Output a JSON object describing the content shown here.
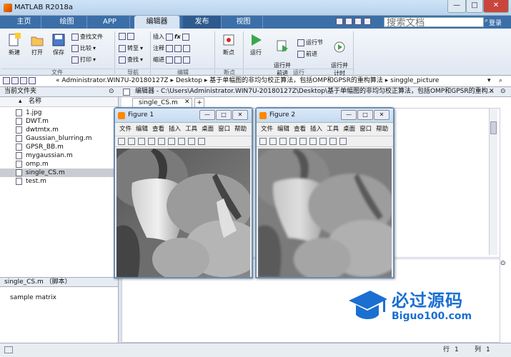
{
  "window": {
    "title": "MATLAB R2018a",
    "min": "—",
    "max": "□",
    "close": "✕"
  },
  "tabs": [
    "主页",
    "绘图",
    "APP",
    "编辑器",
    "发布",
    "视图"
  ],
  "search": {
    "placeholder": "搜索文档",
    "login": "登录"
  },
  "ribbon": {
    "file": {
      "new": "新建",
      "open": "打开",
      "save": "保存",
      "find": "查找文件",
      "compare": "比较",
      "print": "打印",
      "group": "文件"
    },
    "nav": {
      "goto": "转至",
      "find": "查找",
      "group": "导航"
    },
    "edit": {
      "insert": "插入",
      "comment": "注释",
      "indent": "缩进",
      "group": "编辑"
    },
    "breakpoints": {
      "label": "断点",
      "group": "断点"
    },
    "run": {
      "run": "运行",
      "run_advance": "运行并\n前进",
      "run_section": "运行节",
      "advance": "前进",
      "run_time": "运行并\n计时",
      "group": "运行"
    }
  },
  "address": {
    "path": [
      "«",
      "Administrator.WIN7U-20180127Z",
      "Desktop",
      "基于单幅图的非均匀校正算法，包括OMP和GPSR的重构算法",
      "singgle_picture"
    ]
  },
  "current_folder": {
    "title": "当前文件夹",
    "column": "名称",
    "files": [
      "1.jpg",
      "DWT.m",
      "dwtmtx.m",
      "Gaussian_blurring.m",
      "GPSR_BB.m",
      "mygaussian.m",
      "omp.m",
      "single_CS.m",
      "test.m"
    ],
    "selected": "single_CS.m"
  },
  "details": {
    "title": "single_CS.m  （脚本）",
    "text": "sample matrix"
  },
  "editor": {
    "header": "编辑器 - C:\\Users\\Administrator.WIN7U-20180127Z\\Desktop\\基于单幅图的非均匀校正算法，包括OMP和GPSR的重构...",
    "tab": "single_CS.m",
    "add_tab": "+"
  },
  "figures": [
    {
      "title": "Figure 1",
      "menu": [
        "文件",
        "编辑",
        "查看",
        "插入",
        "工具",
        "桌面",
        "窗口",
        "帮助"
      ]
    },
    {
      "title": "Figure 2",
      "menu": [
        "文件",
        "编辑",
        "查看",
        "插入",
        "工具",
        "桌面",
        "窗口",
        "帮助"
      ]
    }
  ],
  "status": {
    "row_label": "行",
    "row": "1",
    "col_label": "列",
    "col": "1"
  },
  "watermark": {
    "brand": "必过源码",
    "url": "Biguo100.com"
  },
  "colors": {
    "tab_bar": "#3c6fa8",
    "selected_tab": "#d6e4f3",
    "accent": "#1a6fd1"
  }
}
